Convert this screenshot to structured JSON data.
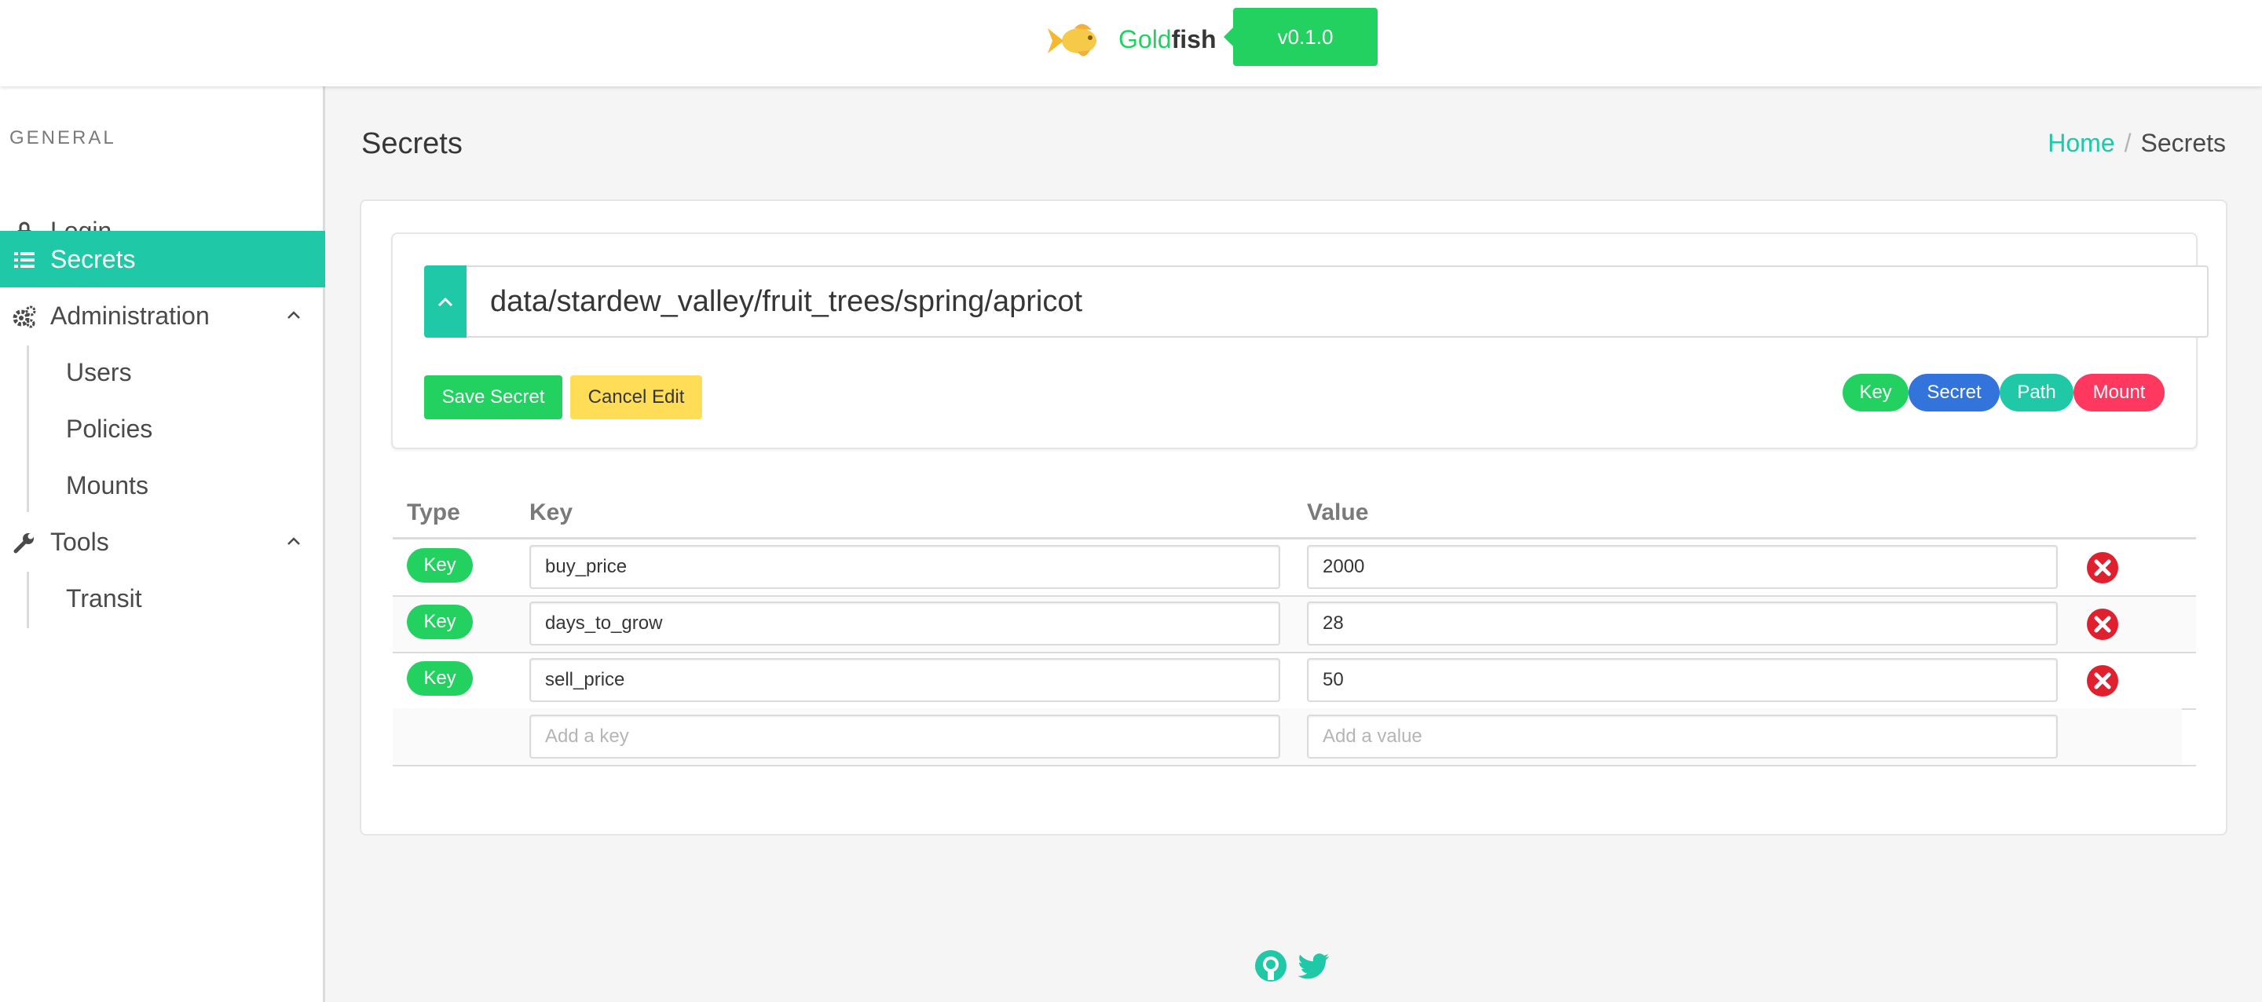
{
  "header": {
    "brand_prefix": "Gold",
    "brand_suffix": "fish",
    "version": "v0.1.0"
  },
  "sidebar": {
    "section_label": "GENERAL",
    "items": [
      {
        "label": "Login",
        "icon": "lock-icon"
      },
      {
        "label": "Secrets",
        "icon": "list-icon",
        "active": true
      },
      {
        "label": "Administration",
        "icon": "cogs-icon"
      },
      {
        "label": "Tools",
        "icon": "wrench-icon"
      }
    ],
    "admin_sub": [
      "Users",
      "Policies",
      "Mounts"
    ],
    "tools_sub": [
      "Transit"
    ]
  },
  "page": {
    "title": "Secrets",
    "breadcrumb_home": "Home",
    "breadcrumb_sep": "/",
    "breadcrumb_current": "Secrets"
  },
  "editor": {
    "path": "data/stardew_valley/fruit_trees/spring/apricot",
    "save_label": "Save Secret",
    "cancel_label": "Cancel Edit",
    "legend": {
      "key": "Key",
      "secret": "Secret",
      "path": "Path",
      "mount": "Mount"
    }
  },
  "table": {
    "headers": {
      "type": "Type",
      "key": "Key",
      "value": "Value"
    },
    "rows": [
      {
        "type": "Key",
        "key": "buy_price",
        "value": "2000"
      },
      {
        "type": "Key",
        "key": "days_to_grow",
        "value": "28"
      },
      {
        "type": "Key",
        "key": "sell_price",
        "value": "50"
      }
    ],
    "add_key_placeholder": "Add a key",
    "add_value_placeholder": "Add a value"
  },
  "colors": {
    "primary": "#1fc8a6",
    "success": "#23d160",
    "warning": "#ffdd57",
    "info": "#3273dc",
    "danger": "#ff3860"
  },
  "footer": {
    "icons": [
      "github-icon",
      "twitter-icon"
    ]
  }
}
